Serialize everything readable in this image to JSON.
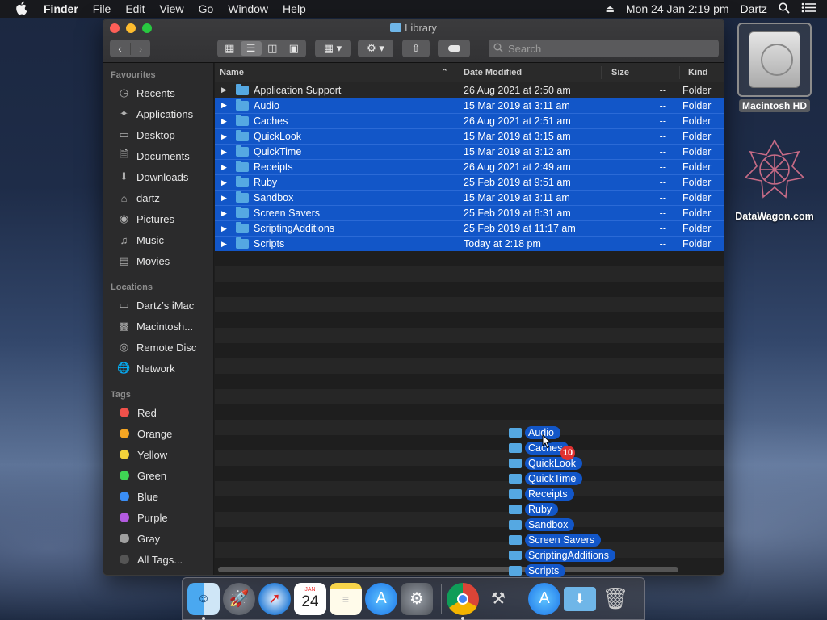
{
  "menubar": {
    "app": "Finder",
    "items": [
      "File",
      "Edit",
      "View",
      "Go",
      "Window",
      "Help"
    ],
    "datetime": "Mon 24 Jan  2:19 pm",
    "user": "Dartz"
  },
  "window": {
    "title": "Library",
    "search_placeholder": "Search"
  },
  "sidebar": {
    "favourites_heading": "Favourites",
    "favourites": [
      {
        "label": "Recents",
        "icon": "clock-icon"
      },
      {
        "label": "Applications",
        "icon": "applications-icon"
      },
      {
        "label": "Desktop",
        "icon": "desktop-icon"
      },
      {
        "label": "Documents",
        "icon": "document-icon"
      },
      {
        "label": "Downloads",
        "icon": "download-icon"
      },
      {
        "label": "dartz",
        "icon": "home-icon"
      },
      {
        "label": "Pictures",
        "icon": "camera-icon"
      },
      {
        "label": "Music",
        "icon": "music-icon"
      },
      {
        "label": "Movies",
        "icon": "film-icon"
      }
    ],
    "locations_heading": "Locations",
    "locations": [
      {
        "label": "Dartz’s iMac",
        "icon": "imac-icon"
      },
      {
        "label": "Macintosh...",
        "icon": "disk-icon"
      },
      {
        "label": "Remote Disc",
        "icon": "disc-icon"
      },
      {
        "label": "Network",
        "icon": "network-icon"
      }
    ],
    "tags_heading": "Tags",
    "tags": [
      {
        "label": "Red",
        "color": "#f0514b"
      },
      {
        "label": "Orange",
        "color": "#f5a623"
      },
      {
        "label": "Yellow",
        "color": "#f3d33b"
      },
      {
        "label": "Green",
        "color": "#3fd454"
      },
      {
        "label": "Blue",
        "color": "#3a8ef6"
      },
      {
        "label": "Purple",
        "color": "#b35be0"
      },
      {
        "label": "Gray",
        "color": "#a0a0a0"
      },
      {
        "label": "All Tags...",
        "color": "#555555"
      }
    ]
  },
  "columns": {
    "name": "Name",
    "date": "Date Modified",
    "size": "Size",
    "kind": "Kind"
  },
  "files": [
    {
      "name": "Application Support",
      "date": "26 Aug 2021 at 2:50 am",
      "size": "--",
      "kind": "Folder",
      "selected": false
    },
    {
      "name": "Audio",
      "date": "15 Mar 2019 at 3:11 am",
      "size": "--",
      "kind": "Folder",
      "selected": true
    },
    {
      "name": "Caches",
      "date": "26 Aug 2021 at 2:51 am",
      "size": "--",
      "kind": "Folder",
      "selected": true
    },
    {
      "name": "QuickLook",
      "date": "15 Mar 2019 at 3:15 am",
      "size": "--",
      "kind": "Folder",
      "selected": true
    },
    {
      "name": "QuickTime",
      "date": "15 Mar 2019 at 3:12 am",
      "size": "--",
      "kind": "Folder",
      "selected": true
    },
    {
      "name": "Receipts",
      "date": "26 Aug 2021 at 2:49 am",
      "size": "--",
      "kind": "Folder",
      "selected": true
    },
    {
      "name": "Ruby",
      "date": "25 Feb 2019 at 9:51 am",
      "size": "--",
      "kind": "Folder",
      "selected": true
    },
    {
      "name": "Sandbox",
      "date": "15 Mar 2019 at 3:11 am",
      "size": "--",
      "kind": "Folder",
      "selected": true
    },
    {
      "name": "Screen Savers",
      "date": "25 Feb 2019 at 8:31 am",
      "size": "--",
      "kind": "Folder",
      "selected": true
    },
    {
      "name": "ScriptingAdditions",
      "date": "25 Feb 2019 at 11:17 am",
      "size": "--",
      "kind": "Folder",
      "selected": true
    },
    {
      "name": "Scripts",
      "date": "Today at 2:18 pm",
      "size": "--",
      "kind": "Folder",
      "selected": true
    }
  ],
  "drag": {
    "items": [
      "Audio",
      "Caches",
      "QuickLook",
      "QuickTime",
      "Receipts",
      "Ruby",
      "Sandbox",
      "Screen Savers",
      "ScriptingAdditions",
      "Scripts"
    ],
    "count": "10"
  },
  "desktop": {
    "hd_label": "Macintosh HD",
    "datawagon_label": "DataWagon.com"
  },
  "dock": {
    "calendar_month": "JAN",
    "calendar_day": "24",
    "apps": [
      "finder-icon",
      "launchpad-icon",
      "safari-icon",
      "calendar-icon",
      "notes-icon",
      "app-store-icon",
      "system-preferences-icon",
      "chrome-icon",
      "archive-utility-icon",
      "app-store-icon",
      "downloads-folder-icon",
      "trash-icon"
    ]
  }
}
